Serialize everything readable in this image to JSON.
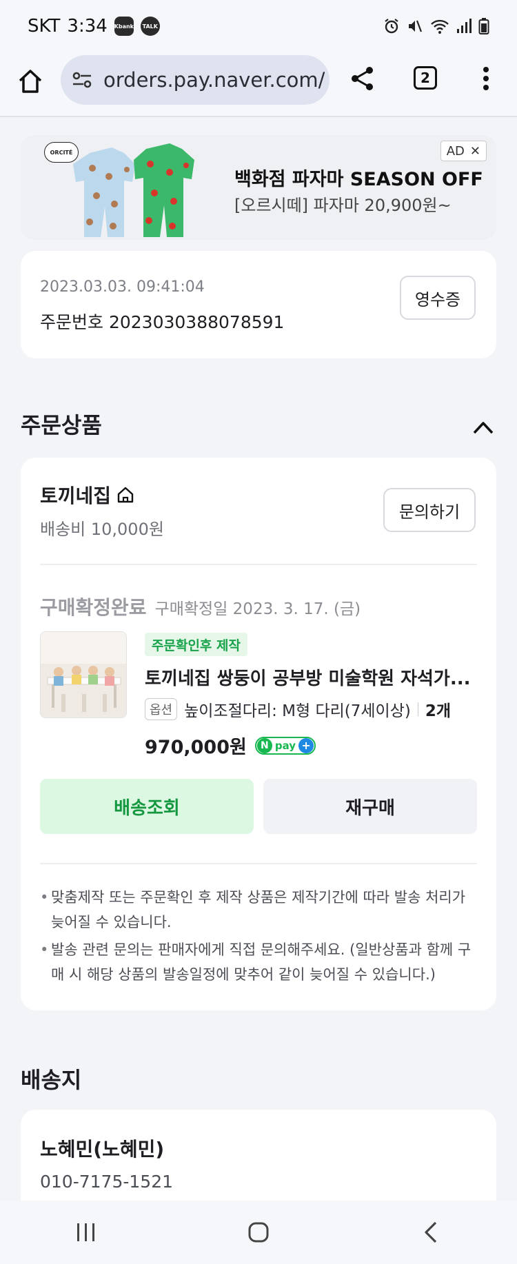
{
  "status_bar": {
    "carrier": "SKT",
    "time": "3:34",
    "app_badges": [
      "Kbank",
      "TALK"
    ]
  },
  "browser": {
    "url": "orders.pay.naver.com/",
    "tab_count": "2"
  },
  "ad": {
    "brand": "ORCITÉ",
    "title": "백화점 파자마 SEASON OFF",
    "subtitle": "[오르시떼] 파자마 20,900원~",
    "tag": "AD",
    "close": "✕"
  },
  "order": {
    "datetime": "2023.03.03. 09:41:04",
    "number_line": "주문번호 2023030388078591",
    "receipt_label": "영수증"
  },
  "products_section": {
    "title": "주문상품",
    "store": {
      "name": "토끼네집",
      "shipping": "배송비 10,000원",
      "inquiry_label": "문의하기"
    },
    "item": {
      "status": "구매확정완료",
      "confirm_date": "구매확정일 2023. 3. 17. (금)",
      "tag": "주문확인후 제작",
      "name": "토끼네집 쌍둥이 공부방 미술학원 자석가...",
      "option_badge": "옵션",
      "option_text": "높이조절다리: M형 다리(7세이상)",
      "quantity": "2개",
      "price": "970,000원",
      "npay_label": "pay"
    },
    "buttons": {
      "track": "배송조회",
      "rebuy": "재구매"
    },
    "notes": [
      "맞춤제작 또는 주문확인 후 제작 상품은 제작기간에 따라 발송 처리가 늦어질 수 있습니다.",
      "발송 관련 문의는 판매자에게 직접 문의해주세요. (일반상품과 함께 구매 시 해당 상품의 발송일정에 맞추어 같이 늦어질 수 있습니다.)"
    ]
  },
  "shipping_section": {
    "title": "배송지",
    "recipient": "노혜민(노혜민)",
    "phone": "010-7175-1521"
  },
  "colors": {
    "page_bg": "#f3f4f7",
    "accent_green": "#13973f",
    "green_tint": "#dcf7e2",
    "npay_green": "#16b84f"
  },
  "icons": [
    "home-icon",
    "tune-icon",
    "share-icon",
    "tabs-icon",
    "more-vert-icon",
    "store-home-icon",
    "chevron-up-icon",
    "recents-icon",
    "home-nav-icon",
    "back-icon"
  ]
}
